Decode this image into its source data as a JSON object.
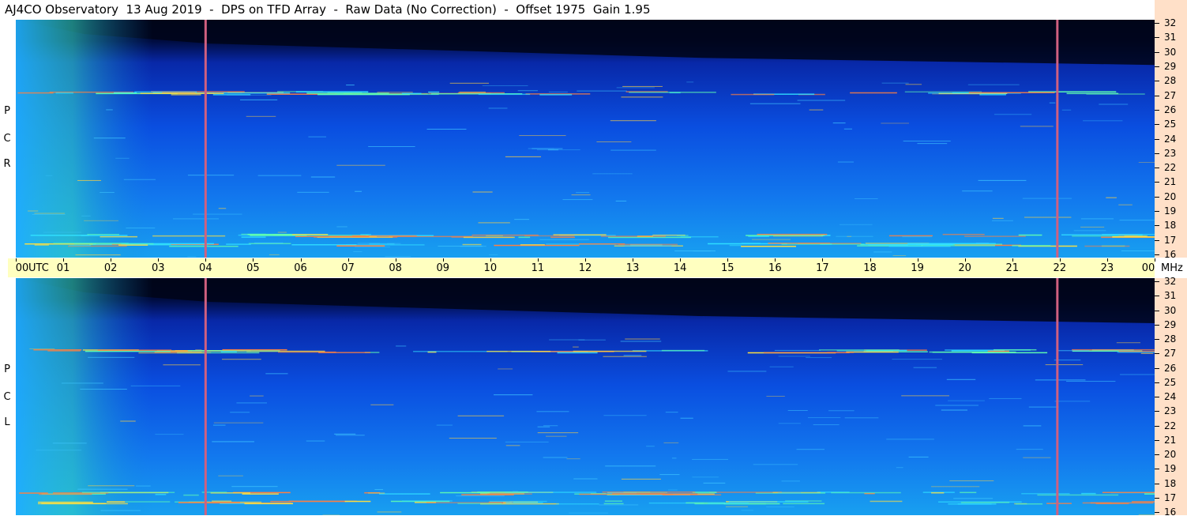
{
  "title": "AJ4CO Observatory  13 Aug 2019  -  DPS on TFD Array  -  Raw Data (No Correction)  -  Offset 1975  Gain 1.95",
  "colors": {
    "background_dark": "#0a1040",
    "time_bar": "#ffffc0",
    "freq_scale": "#ffe0c8",
    "marker_line": "#d06080"
  },
  "chart_data": [
    {
      "type": "heatmap",
      "panel": "RCP",
      "panel_label": [
        "R",
        "C",
        "P"
      ],
      "x_ticks": [
        "00",
        "01",
        "02",
        "03",
        "04",
        "05",
        "06",
        "07",
        "08",
        "09",
        "10",
        "11",
        "12",
        "13",
        "14",
        "15",
        "16",
        "17",
        "18",
        "19",
        "20",
        "21",
        "22",
        "23",
        "00"
      ],
      "x_unit_label": "UTC",
      "xlim": [
        0,
        24
      ],
      "y_ticks": [
        32,
        31,
        30,
        29,
        28,
        27,
        26,
        25,
        24,
        23,
        22,
        21,
        20,
        19,
        18,
        17,
        16
      ],
      "y_unit": "MHz",
      "ylim": [
        16,
        32
      ],
      "marker_times": [
        4.0,
        21.95
      ],
      "bright_bands_mhz": [
        27.1,
        17.5,
        16.9
      ]
    },
    {
      "type": "heatmap",
      "panel": "LCP",
      "panel_label": [
        "L",
        "C",
        "P"
      ],
      "xlim": [
        0,
        24
      ],
      "y_ticks": [
        32,
        31,
        30,
        29,
        28,
        27,
        26,
        25,
        24,
        23,
        22,
        21,
        20,
        19,
        18,
        17,
        16
      ],
      "ylim": [
        16,
        32
      ],
      "marker_times": [
        4.0,
        21.95
      ],
      "bright_bands_mhz": [
        27.1,
        17.5,
        16.9
      ]
    }
  ]
}
